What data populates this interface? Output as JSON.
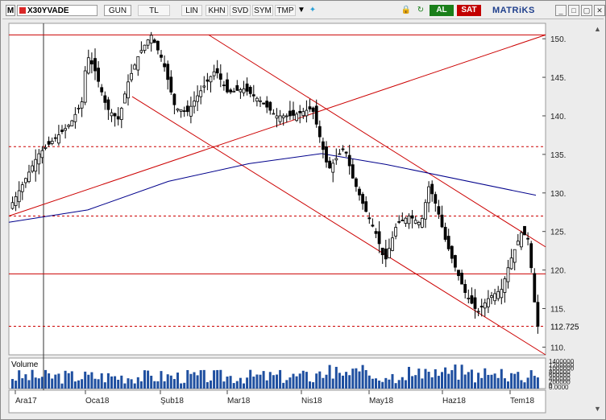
{
  "toolbar": {
    "logo": "M",
    "symbol": "X30YVADE",
    "period": "GUN",
    "currency": "TL",
    "buttons": [
      "LIN",
      "KHN",
      "SVD",
      "SYM",
      "TMP"
    ],
    "buy_label": "AL",
    "sell_label": "SAT",
    "brand": "MATRiKS",
    "colors": {
      "buy": "#1a7f1a",
      "sell": "#c20000",
      "brand": "#1f3f8c"
    }
  },
  "chart_data": {
    "type": "candlestick",
    "symbol": "X30YVADE",
    "ylim": [
      109,
      152
    ],
    "y_ticks": [
      150,
      145,
      140,
      135,
      130,
      125,
      120,
      115,
      110
    ],
    "last_price_label": "112.725",
    "x_ticks": [
      "Ara17",
      "Oca18",
      "Şub18",
      "Mar18",
      "Nis18",
      "May18",
      "Haz18",
      "Tem18"
    ],
    "grid": false,
    "moving_average": {
      "color": "#00008b",
      "values": [
        126.2,
        127.8,
        131.5,
        133.8,
        135.1,
        133.7,
        129.7
      ]
    },
    "horizontal_levels": [
      {
        "value": 150.5,
        "style": "solid",
        "color": "#cc0000"
      },
      {
        "value": 136,
        "style": "dashed",
        "color": "#cc0000"
      },
      {
        "value": 127,
        "style": "dashed",
        "color": "#cc0000"
      },
      {
        "value": 119.5,
        "style": "solid",
        "color": "#cc0000"
      },
      {
        "value": 112.7,
        "style": "dashed",
        "color": "#cc0000"
      }
    ],
    "trend_lines": [
      {
        "from": [
          "Ara17",
          127
        ],
        "to": [
          "Tem18",
          150.5
        ],
        "color": "#cc0000"
      },
      {
        "from": [
          "Oca18",
          142.5
        ],
        "to": [
          "Tem18",
          109
        ],
        "color": "#cc0000"
      },
      {
        "from": [
          "Şub18",
          150.5
        ],
        "to": [
          "Tem18",
          123
        ],
        "color": "#cc0000"
      }
    ],
    "up_color": "#ffffff",
    "down_color": "#000000",
    "volume": {
      "label": "Volume",
      "y_ticks": [
        "1400000",
        "1200000",
        "1000000",
        "800000",
        "600000",
        "400000",
        "200000",
        "0"
      ],
      "bottom_label": "0.0000",
      "color": "#1f4fa0"
    }
  }
}
